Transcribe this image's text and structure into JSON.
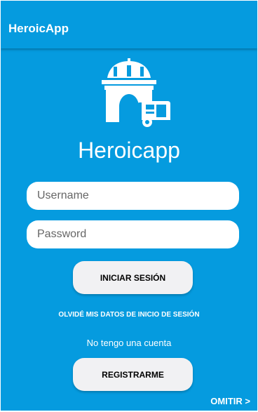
{
  "app_bar": {
    "title": "HeroicApp"
  },
  "logo": {
    "icon_name": "heroicapp-logo-icon"
  },
  "brand": {
    "name": "Heroicapp"
  },
  "form": {
    "username_placeholder": "Username",
    "username_value": "",
    "password_placeholder": "Password",
    "password_value": ""
  },
  "actions": {
    "login_label": "INICIAR SESIÓN",
    "forgot_label": "OLVIDÉ MIS DATOS DE INICIO DE SESIÓN",
    "no_account_text": "No tengo una cuenta",
    "register_label": "REGISTRARME",
    "skip_label": "OMITIR >"
  },
  "colors": {
    "primary": "#059bdf",
    "surface": "#ffffff",
    "button": "#f1f1f3",
    "text_dark": "#000000",
    "placeholder": "#666666"
  }
}
